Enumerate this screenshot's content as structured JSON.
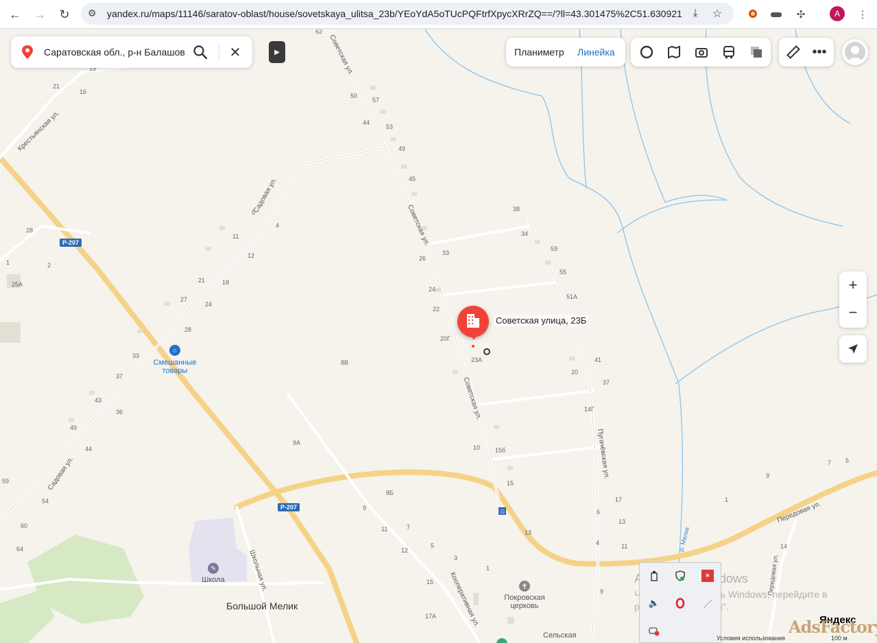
{
  "browser": {
    "url": "yandex.ru/maps/11146/saratov-oblast/house/sovetskaya_ulitsa_23b/YEoYdA5oTUcPQFtrfXpycXRrZQ==/?ll=43.301475%2C51.630921...",
    "profile_initial": "A"
  },
  "search": {
    "value": "Саратовская обл., р-н Балашовс"
  },
  "measure": {
    "planimeter": "Планиметр",
    "ruler": "Линейка"
  },
  "map": {
    "selected_label": "Советская улица, 23Б",
    "village": "Большой Мелик",
    "road_code": "Р-207",
    "pois": {
      "shop": "Смешанные\nтовары",
      "school": "Школа",
      "church": "Покровская\nцерковь",
      "rural": "Сельская"
    },
    "streets": {
      "sovetskaya": "Советская ул.",
      "sadovaya": "Садовая ул.",
      "krestyanskaya": "Крестьянская ул.",
      "pugachevskaya": "Пугачёвская ул.",
      "shkolnaya": "Школьная ул.",
      "kooperativnaya": "Кооперативная ул.",
      "peredovaya": "Передовая ул.",
      "river": "р. Мелик"
    },
    "house_numbers": [
      "62",
      "19",
      "21",
      "16",
      "50",
      "57",
      "44",
      "53",
      "49",
      "45",
      "5",
      "4",
      "38",
      "34",
      "59",
      "55",
      "51А",
      "28",
      "1",
      "11",
      "12",
      "2",
      "25А",
      "21",
      "18",
      "27",
      "24",
      "26",
      "33",
      "24",
      "22",
      "20Г",
      "23А",
      "8В",
      "28",
      "33",
      "37",
      "43",
      "36",
      "49",
      "44",
      "41",
      "37",
      "20",
      "14Г",
      "10",
      "15б",
      "9А",
      "59",
      "54",
      "60",
      "64",
      "15",
      "13",
      "17",
      "13",
      "6",
      "4",
      "11",
      "9",
      "8Б",
      "9",
      "7",
      "11",
      "12",
      "5",
      "3",
      "1",
      "15",
      "17А",
      "9",
      "7",
      "5",
      "1",
      "14"
    ]
  },
  "watermark": {
    "title": "Активация Windows",
    "text": "Чтобы активировать Windows, перейдите в раздел \"Параметры\"."
  },
  "footer": {
    "yandex": "Яндекс",
    "terms": "Условия использования",
    "scale": "100 м",
    "adsfactory": "AdsFactory"
  },
  "colors": {
    "map_bg": "#f5f3ec",
    "highway": "#f7d27e",
    "river": "#6ab0e6",
    "marker": "#f0423a",
    "accent": "#1e6fc7"
  }
}
